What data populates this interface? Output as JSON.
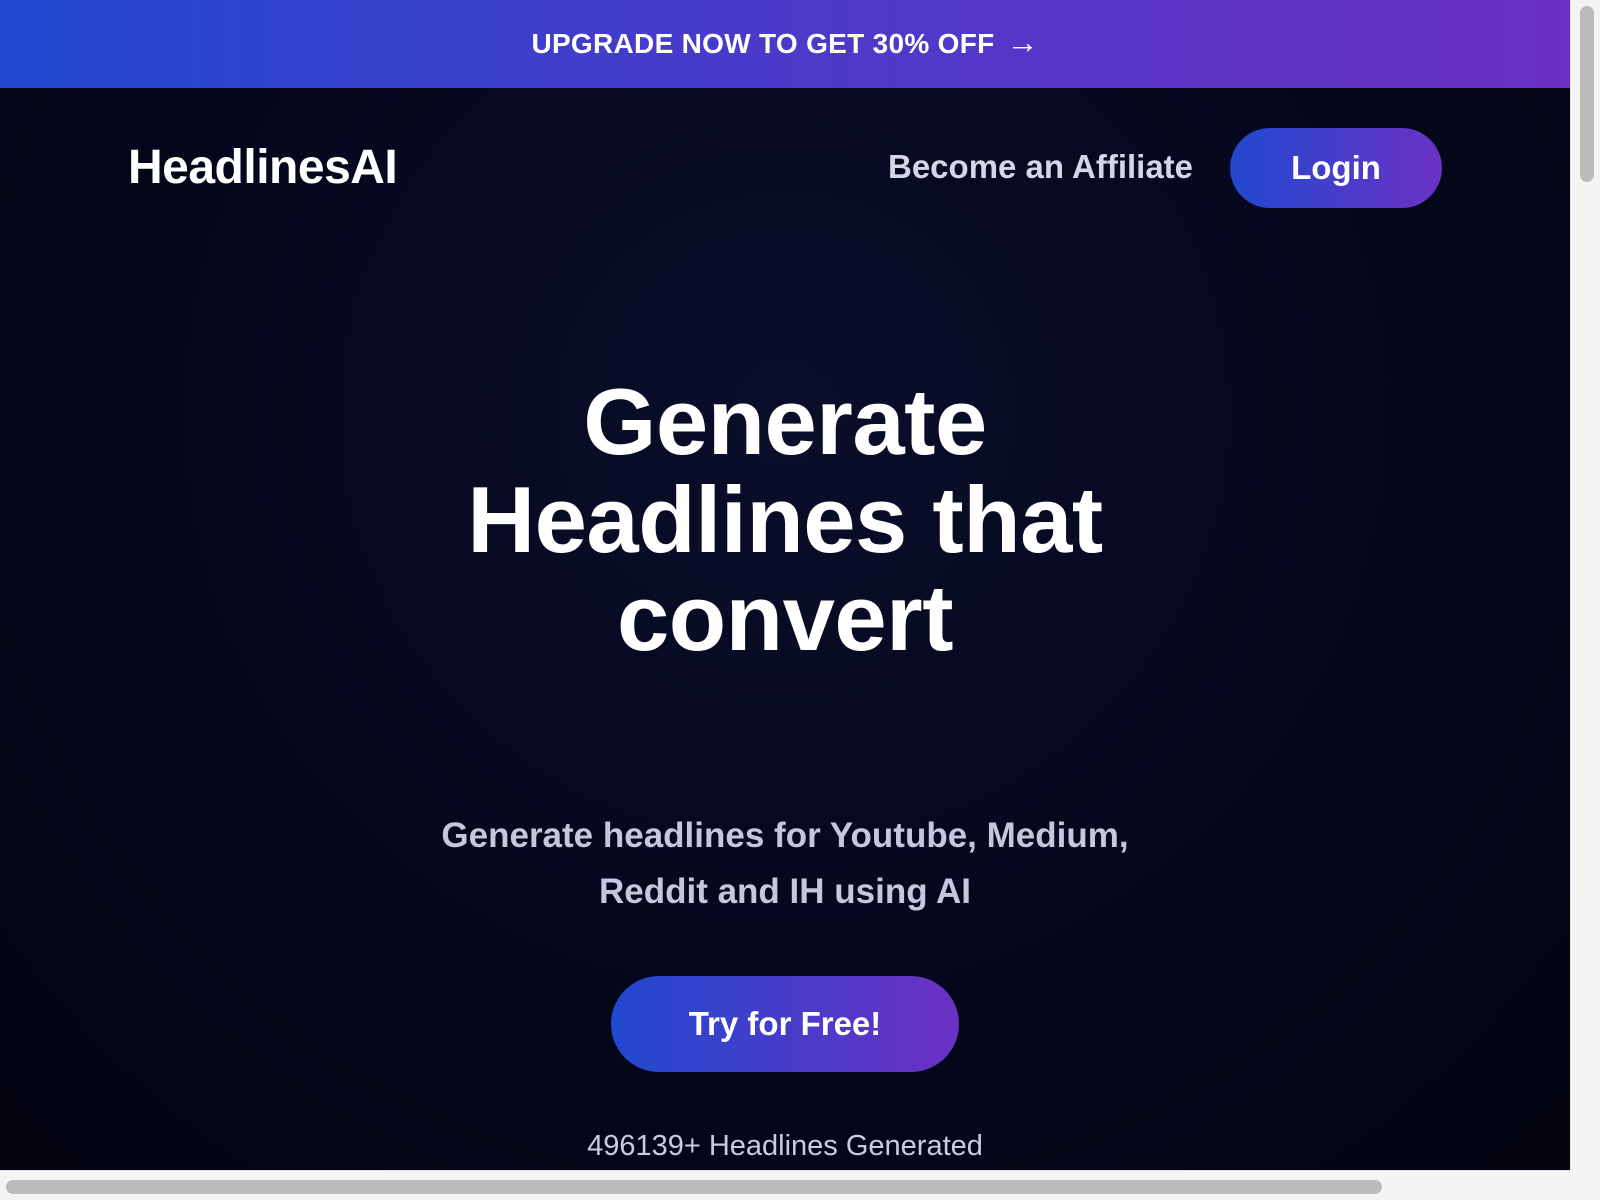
{
  "promo": {
    "text": "UPGRADE NOW TO GET 30% OFF",
    "arrow": "→",
    "gradient": [
      "#2149cf",
      "#6a2fc4"
    ]
  },
  "nav": {
    "brand": "HeadlinesAI",
    "affiliate_label": "Become an Affiliate",
    "login_label": "Login"
  },
  "hero": {
    "headline_lines": [
      "Generate",
      "Headlines that",
      "convert"
    ],
    "subhead_lines": [
      "Generate headlines for Youtube, Medium,",
      "Reddit and IH using AI"
    ],
    "cta_label": "Try for Free!",
    "counter_text": "496139+ Headlines Generated"
  },
  "colors": {
    "background": "#04061a",
    "accent_start": "#2148cf",
    "accent_end": "#6b31c4",
    "text": "#ffffff",
    "muted_text": "#c4c8dc"
  }
}
